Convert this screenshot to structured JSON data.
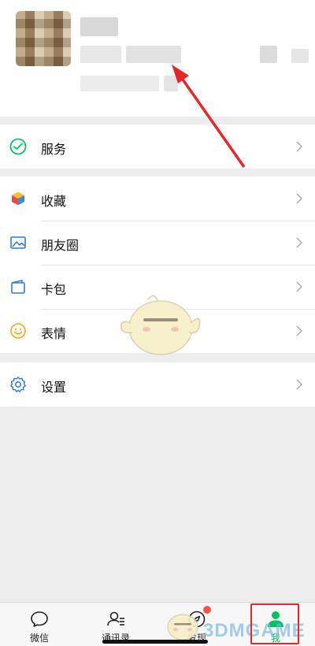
{
  "profile": {
    "avatar_icon": "avatar-image",
    "nickname": "",
    "wechat_id": "",
    "status": ""
  },
  "menu": {
    "services": {
      "label": "服务",
      "icon": "wechat-pay-icon"
    },
    "favorites": {
      "label": "收藏",
      "icon": "cube-icon"
    },
    "moments": {
      "label": "朋友圈",
      "icon": "image-icon"
    },
    "card_wallet": {
      "label": "卡包",
      "icon": "wallet-icon"
    },
    "stickers": {
      "label": "表情",
      "icon": "smile-icon"
    },
    "settings": {
      "label": "设置",
      "icon": "gear-icon"
    }
  },
  "tabbar": {
    "chats": "微信",
    "contacts": "通讯录",
    "discover": "发现",
    "me": "我"
  },
  "watermark": "3DMGAME",
  "colors": {
    "accent": "#07c160",
    "annotation": "#e5262a",
    "background": "#ededed"
  }
}
